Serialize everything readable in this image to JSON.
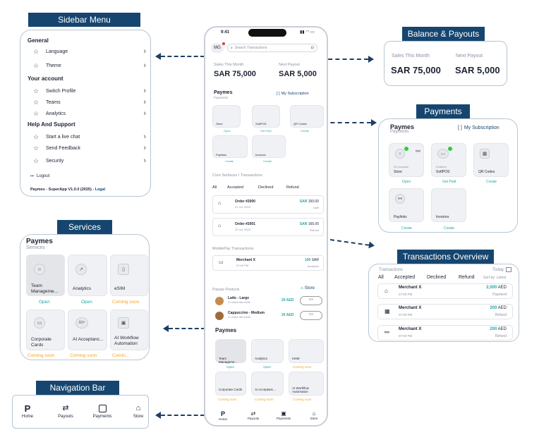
{
  "labels": {
    "sidebar_menu": "Sidebar Menu",
    "balance_payouts": "Balance & Payouts",
    "payments": "Payments",
    "services": "Services",
    "transactions_overview": "Transactions Overview",
    "navigation_bar": "Navigation Bar"
  },
  "sidebar": {
    "general": "General",
    "language": "Language",
    "theme": "Theme",
    "your_account": "Your account",
    "switch_profile": "Switch Profile",
    "teams": "Teams",
    "analytics": "Analytics",
    "help": "Help And Support",
    "live_chat": "Start a live chat",
    "feedback": "Send Feedback",
    "security": "Security",
    "logout": "Logout",
    "footer": "Paymes - SuperApp V1.0.0 (2025) -",
    "legal": "Legal"
  },
  "balance": {
    "sales_label": "Sales This Month",
    "sales_value": "SAR 75,000",
    "payout_label": "Next Payout",
    "payout_value": "SAR 5,000"
  },
  "payments": {
    "brand": "Paymes",
    "sub": "Payments",
    "subscription": "My Subscription",
    "store_top": "24 products",
    "store": "Store",
    "softpos_top": "Enabled",
    "softpos": "SoftPOS",
    "qr": "QR Codes",
    "paylinks": "Paylinks",
    "invoices": "Invoices",
    "open": "Open",
    "get_paid": "Get Paid",
    "create": "Create"
  },
  "services": {
    "brand": "Paymes",
    "sub": "Services",
    "team": "Team Manageme...",
    "analytics": "Analytics",
    "esim": "eSIM",
    "open": "Open",
    "coming": "Coming soon",
    "corporate": "Corporate Cards",
    "ai_acc": "AI Acceptanc...",
    "ai_flow": "AI Workflow Automation",
    "ai_badge": "AI+",
    "coming_cut": "Comin..."
  },
  "transactions": {
    "label": "Transactions",
    "today": "Today",
    "sort": "Sort by: Latest",
    "tabs": [
      "All",
      "Accepted",
      "Declined",
      "Refund"
    ],
    "rows": [
      {
        "name": "Merchant X",
        "time": "07:00 PM",
        "amount": "2,000",
        "cur": "AED",
        "status": "Payment"
      },
      {
        "name": "Merchant X",
        "time": "07:00 PM",
        "amount": "200",
        "cur": "AED",
        "status": "Refund"
      },
      {
        "name": "Merchant X",
        "time": "07:00 PM",
        "amount": "200",
        "cur": "AED",
        "status": "Refund"
      }
    ]
  },
  "navbar": {
    "home": "Home",
    "payouts": "Payouts",
    "payments": "Payments",
    "store": "Store"
  },
  "phone": {
    "time": "9:41",
    "avatar": "MG",
    "search_placeholder": "Search Transactions",
    "core_surfaces": "Core Surfaces / Transactions",
    "tabs": [
      "All",
      "Accepted",
      "Declined",
      "Refund"
    ],
    "orders": [
      {
        "name": "Order #2000",
        "date": "21 Jul, 2025",
        "cur": "SAR",
        "amount": "150.00",
        "status": "Sale"
      },
      {
        "name": "Order #2001",
        "date": "20 Jul, 2025",
        "cur": "SAR",
        "amount": "165.00",
        "status": "Refund"
      }
    ],
    "mobilepay": "MobilePay Transactions",
    "mp_name": "Merchant X",
    "mp_time": "07:00 PM",
    "mp_amount": "100",
    "mp_cur": "SAR",
    "mp_status": "Accepted",
    "popular": "Popular Products",
    "store_link": "Store",
    "products": [
      {
        "name": "Latte - Large",
        "sub": "21 orders this month",
        "price": "20 AED"
      },
      {
        "name": "Cappuccino - Medium",
        "sub": "21 orders this month",
        "price": "20 AED"
      }
    ],
    "nav_store": "Store"
  },
  "colors": {
    "navy": "#16466f",
    "teal": "#23a6a6",
    "orange": "#f0a52a",
    "green": "#2ecc40"
  }
}
